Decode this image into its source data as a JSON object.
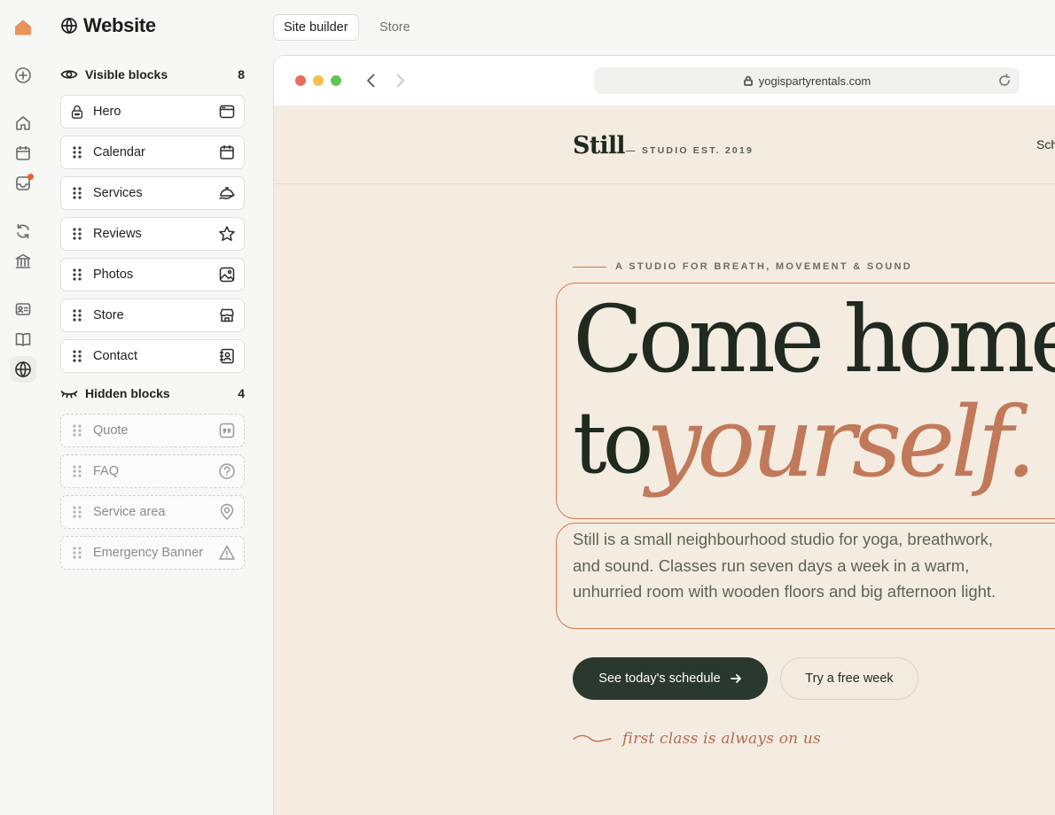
{
  "rail": {
    "icons": [
      "home-logo-icon",
      "add-icon",
      "house-icon",
      "calendar-icon",
      "inbox-icon",
      "sync-icon",
      "bank-icon",
      "contact-card-icon",
      "book-icon",
      "globe-icon"
    ],
    "active": "globe-icon",
    "accent": "#e8935a",
    "badge_color": "#e8622c"
  },
  "sidebar": {
    "title": "Website",
    "visible_group": {
      "label": "Visible blocks",
      "count": "8"
    },
    "visible_blocks": [
      {
        "label": "Hero",
        "icon": "browser-window-icon",
        "locked": true
      },
      {
        "label": "Calendar",
        "icon": "calendar-icon"
      },
      {
        "label": "Services",
        "icon": "service-bell-icon"
      },
      {
        "label": "Reviews",
        "icon": "star-icon"
      },
      {
        "label": "Photos",
        "icon": "image-icon"
      },
      {
        "label": "Store",
        "icon": "storefront-icon"
      },
      {
        "label": "Contact",
        "icon": "contact-book-icon"
      }
    ],
    "hidden_group": {
      "label": "Hidden blocks",
      "count": "4"
    },
    "hidden_blocks": [
      {
        "label": "Quote",
        "icon": "quote-icon"
      },
      {
        "label": "FAQ",
        "icon": "question-icon"
      },
      {
        "label": "Service area",
        "icon": "location-pin-icon"
      },
      {
        "label": "Emergency Banner",
        "icon": "warning-icon"
      }
    ]
  },
  "tabs": [
    {
      "label": "Site builder",
      "active": true
    },
    {
      "label": "Store",
      "active": false
    }
  ],
  "browser": {
    "url": "yogispartyrentals.com"
  },
  "site": {
    "brand": "Still",
    "brand_sub": "— STUDIO EST. 2019",
    "nav_peek": "Sch",
    "eyebrow": "A STUDIO FOR BREATH, MOVEMENT & SOUND",
    "headline_1": "Come home",
    "headline_2": "to",
    "headline_accent": "yourself.",
    "paragraph": "Still is a small neighbourhood studio for yoga, breathwork, and sound. Classes run seven days a week in a warm, unhurried room with wooden floors and big afternoon light.",
    "primary_cta": "See today's schedule",
    "secondary_cta": "Try a free week",
    "script_note": "first class is always on us",
    "colors": {
      "bg": "#f4ece1",
      "dark": "#2b382d",
      "accent": "#c1795a",
      "selection": "#d47848"
    }
  }
}
